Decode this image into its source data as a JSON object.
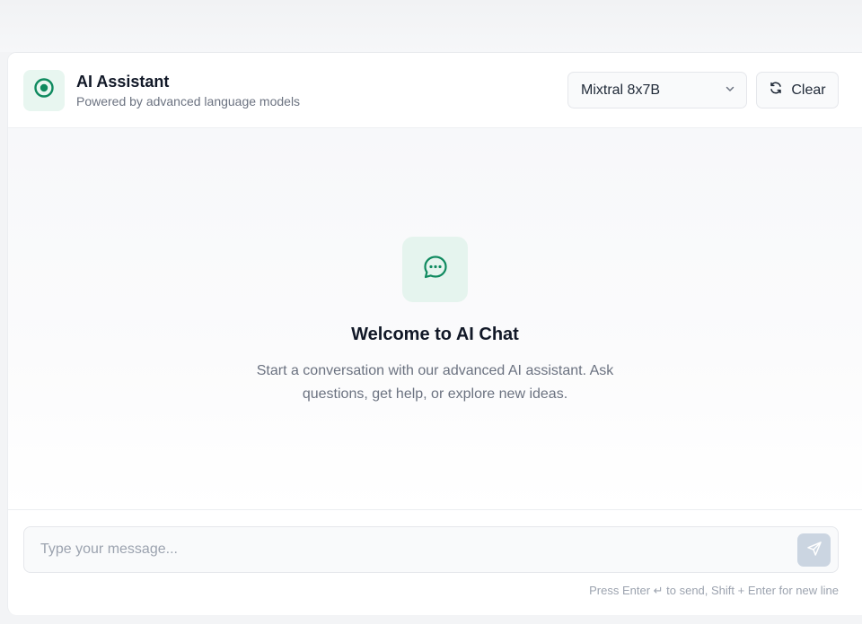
{
  "header": {
    "title": "AI Assistant",
    "subtitle": "Powered by advanced language models",
    "model_select": {
      "value": "Mixtral 8x7B"
    },
    "clear_label": "Clear"
  },
  "welcome": {
    "title": "Welcome to AI Chat",
    "text": "Start a conversation with our advanced AI assistant. Ask questions, get help, or explore new ideas."
  },
  "composer": {
    "placeholder": "Type your message...",
    "hint": "Press Enter ↵ to send, Shift + Enter for new line"
  },
  "colors": {
    "accent": "#0f8a5f",
    "accent_bg": "#e8f6f0",
    "send_disabled": "#cbd5e1"
  },
  "icons": {
    "logo": "target-icon",
    "select": "chevron-down-icon",
    "clear": "refresh-icon",
    "welcome": "chat-bubble-icon",
    "send": "send-icon"
  }
}
